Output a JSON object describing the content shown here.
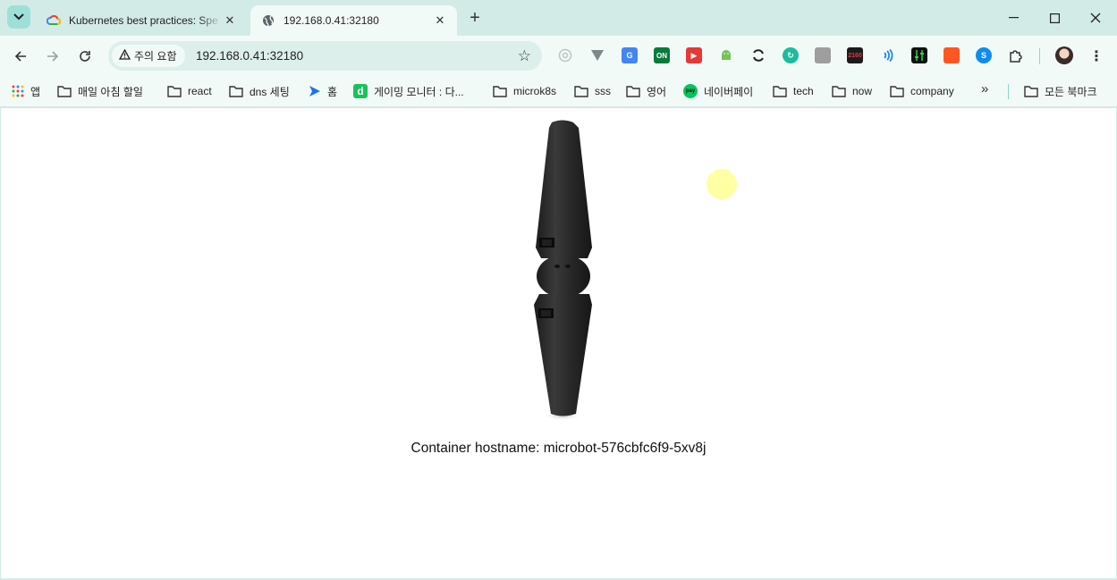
{
  "tabs": [
    {
      "title": "Kubernetes best practices: Spe",
      "favicon": "google-cloud-icon",
      "active": false
    },
    {
      "title": "192.168.0.41:32180",
      "favicon": "globe-icon",
      "active": true
    }
  ],
  "omnibox": {
    "security_chip": "주의 요함",
    "url": "192.168.0.41:32180"
  },
  "extensions": [
    {
      "name": "extension-icon-1",
      "color": "#c9d4d2"
    },
    {
      "name": "extension-icon-2",
      "color": "#7a8a88"
    },
    {
      "name": "google-translate-icon",
      "color": "#4285f4"
    },
    {
      "name": "on-toggle-icon",
      "label": "ON",
      "color": "#0a7a3b"
    },
    {
      "name": "youtube-icon",
      "color": "#e53935"
    },
    {
      "name": "android-icon",
      "color": "#78c257"
    },
    {
      "name": "sync-icon",
      "color": "#222222"
    },
    {
      "name": "refresh-green-icon",
      "color": "#1abc9c"
    },
    {
      "name": "person-image-icon",
      "color": "#9e9e9e"
    },
    {
      "name": "2160-icon",
      "label": "2160",
      "color": "#1b1b1b"
    },
    {
      "name": "wifi-signal-icon",
      "color": "#1e88e5"
    },
    {
      "name": "equalizer-icon",
      "color": "#111111"
    },
    {
      "name": "shopping-bag-icon",
      "color": "#ff5722"
    },
    {
      "name": "shazam-icon",
      "color": "#0d8df1"
    },
    {
      "name": "puzzle-icon",
      "color": "#333333"
    }
  ],
  "bookmarks": [
    {
      "label": "앱",
      "icon": "apps-grid-icon"
    },
    {
      "label": "매일 아침 할일",
      "icon": "folder-icon"
    },
    {
      "label": "react",
      "icon": "folder-icon"
    },
    {
      "label": "dns 세팅",
      "icon": "folder-icon"
    },
    {
      "label": "홈",
      "icon": "play-arrow-icon"
    },
    {
      "label": "게이밍 모니터 : 다...",
      "icon": "d-logo-icon"
    },
    {
      "label": "microk8s",
      "icon": "folder-icon"
    },
    {
      "label": "sss",
      "icon": "folder-icon"
    },
    {
      "label": "영어",
      "icon": "folder-icon"
    },
    {
      "label": "네이버페이",
      "icon": "naver-pay-icon"
    },
    {
      "label": "tech",
      "icon": "folder-icon"
    },
    {
      "label": "now",
      "icon": "folder-icon"
    },
    {
      "label": "company",
      "icon": "folder-icon"
    }
  ],
  "bookmarks_more": "»",
  "all_bookmarks": "모든 북마크",
  "page": {
    "hostname_text": "Container hostname: microbot-576cbfc6f9-5xv8j"
  }
}
